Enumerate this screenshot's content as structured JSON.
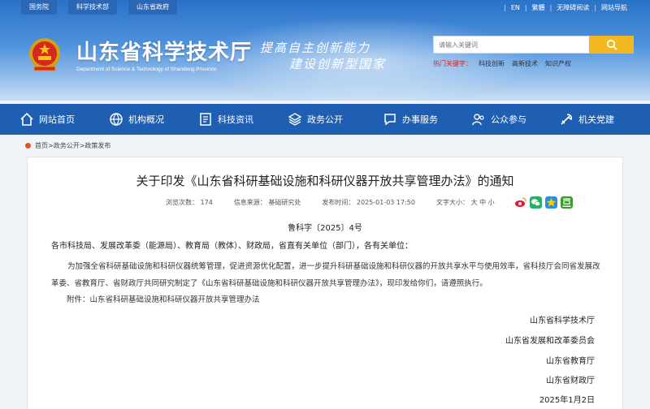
{
  "header": {
    "top_links": [
      "国务院",
      "科学技术部",
      "山东省政府"
    ],
    "utils": [
      "EN",
      "繁體",
      "无障碍阅读",
      "网站导航"
    ],
    "site_title": "山东省科学技术厅",
    "site_subtitle": "Department of Science & Technology of Shandong Province",
    "slogan_line1": "提高自主创新能力",
    "slogan_line2": "建设创新型国家",
    "search_placeholder": "请输入关键词",
    "hot_label": "热门关键字：",
    "hot_keywords": [
      "科技创新",
      "高新技术",
      "知识产权"
    ]
  },
  "nav": [
    {
      "label": "网站首页",
      "icon": "home-icon"
    },
    {
      "label": "机构概况",
      "icon": "globe-icon"
    },
    {
      "label": "科技资讯",
      "icon": "news-icon"
    },
    {
      "label": "政务公开",
      "icon": "layers-icon"
    },
    {
      "label": "办事服务",
      "icon": "chat-icon"
    },
    {
      "label": "公众参与",
      "icon": "people-icon"
    },
    {
      "label": "机关党建",
      "icon": "party-icon"
    }
  ],
  "breadcrumb": "首页>政务公开>政策发布",
  "article": {
    "title": "关于印发《山东省科研基础设施和科研仪器开放共享管理办法》的通知",
    "views": "浏览次数： 174",
    "source": "信息来源： 基础研究处",
    "date": "发布时间： 2025-01-03 17:50",
    "font_size": "文字大小： 大 中 小",
    "doc_no": "鲁科字〔2025〕4号",
    "salutation": "各市科技局、发展改革委（能源局）、教育局（教体）、财政局，省直有关单位（部门），各有关单位：",
    "body": "为加强全省科研基础设施和科研仪器统筹管理，促进资源优化配置，进一步提升科研基础设施和科研仪器的开放共享水平与使用效率，省科技厅会同省发展改革委、省教育厅、省财政厅共同研究制定了《山东省科研基础设施和科研仪器开放共享管理办法》，现印发给你们，请遵照执行。",
    "attachment": "附件：山东省科研基础设施和科研仪器开放共享管理办法",
    "signatures": [
      "山东省科学技术厅",
      "山东省发展和改革委员会",
      "山东省教育厅",
      "山东省财政厅"
    ],
    "sign_date": "2025年1月2日"
  },
  "colors": {
    "nav_bg": "#1f5fb3",
    "search_btn": "#f3b81f",
    "hot_label": "#d7261e"
  }
}
